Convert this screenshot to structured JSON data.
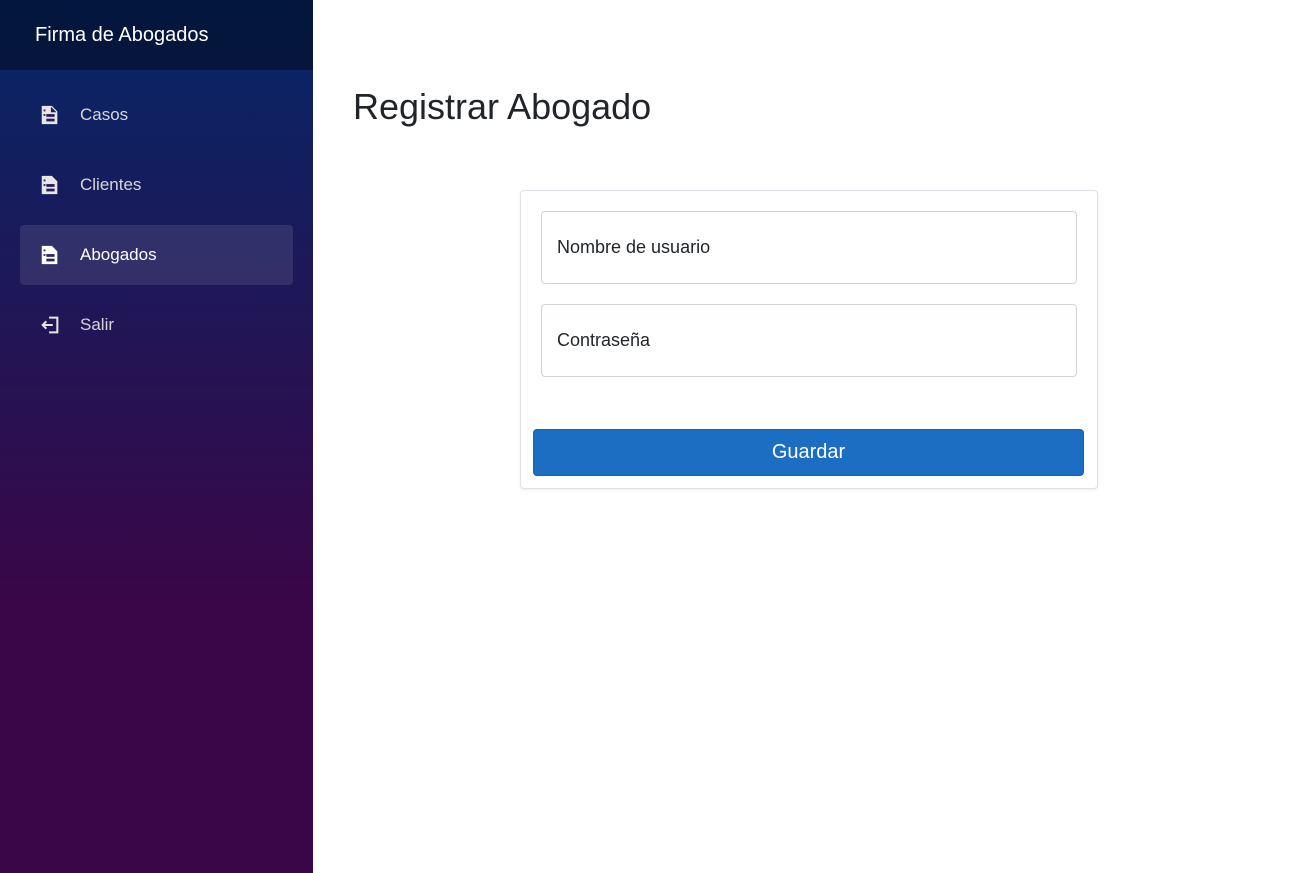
{
  "brand": {
    "title": "Firma de Abogados"
  },
  "sidebar": {
    "items": [
      {
        "label": "Casos",
        "icon": "document-icon"
      },
      {
        "label": "Clientes",
        "icon": "document-icon"
      },
      {
        "label": "Abogados",
        "icon": "document-icon",
        "active": true
      },
      {
        "label": "Salir",
        "icon": "logout-icon"
      }
    ]
  },
  "main": {
    "title": "Registrar Abogado",
    "form": {
      "username_placeholder": "Nombre de usuario",
      "password_placeholder": "Contraseña",
      "save_label": "Guardar"
    }
  },
  "colors": {
    "sidebar_top": "#052767",
    "sidebar_bottom": "#3a0647",
    "primary_button": "#1b6ec2"
  }
}
